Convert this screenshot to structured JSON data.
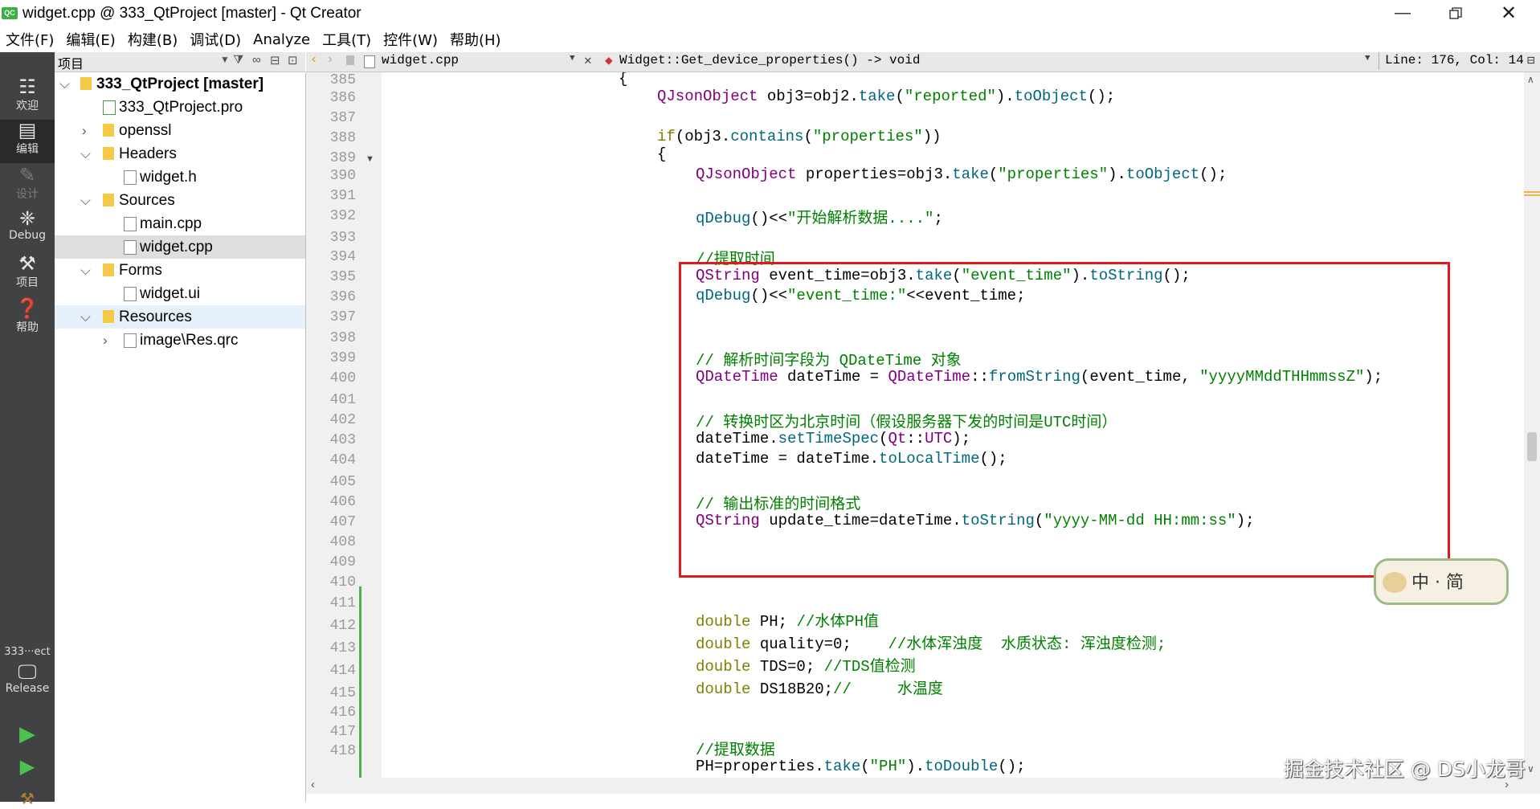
{
  "window": {
    "title": "widget.cpp @ 333_QtProject [master] - Qt Creator",
    "app_icon": "QC",
    "min_icon": "minimize-icon",
    "max_icon": "restore-icon",
    "close_icon": "close-icon"
  },
  "menu": [
    "文件(F)",
    "编辑(E)",
    "构建(B)",
    "调试(D)",
    "Analyze",
    "工具(T)",
    "控件(W)",
    "帮助(H)"
  ],
  "modes": [
    {
      "label": "欢迎",
      "icon": "grid-icon"
    },
    {
      "label": "编辑",
      "icon": "edit-icon"
    },
    {
      "label": "设计",
      "icon": "pencil-icon"
    },
    {
      "label": "Debug",
      "icon": "bug-icon"
    },
    {
      "label": "项目",
      "icon": "wrench-icon"
    },
    {
      "label": "帮助",
      "icon": "help-icon"
    }
  ],
  "kit": {
    "project": "333···ect",
    "config": "Release"
  },
  "project_pane": {
    "title": "项目"
  },
  "tree": [
    {
      "label": "333_QtProject [master]",
      "bold": true
    },
    {
      "label": "333_QtProject.pro"
    },
    {
      "label": "openssl"
    },
    {
      "label": "Headers"
    },
    {
      "label": "widget.h"
    },
    {
      "label": "Sources"
    },
    {
      "label": "main.cpp"
    },
    {
      "label": "widget.cpp"
    },
    {
      "label": "Forms"
    },
    {
      "label": "widget.ui"
    },
    {
      "label": "Resources"
    },
    {
      "label": "image\\Res.qrc"
    }
  ],
  "editor": {
    "file": "widget.cpp",
    "function": "Widget::Get_device_properties() -> void",
    "position": "Line: 176, Col: 14"
  },
  "line_numbers": [
    "385",
    "386",
    "387",
    "388",
    "389",
    "390",
    "391",
    "392",
    "393",
    "394",
    "395",
    "396",
    "397",
    "398",
    "399",
    "400",
    "401",
    "402",
    "403",
    "404",
    "405",
    "406",
    "407",
    "408",
    "409",
    "410",
    "411",
    "412",
    "413",
    "414",
    "415",
    "416",
    "417",
    "418"
  ],
  "code": {
    "l385": "{",
    "l386": "QJsonObject obj3=obj2.take(\"reported\").toObject();",
    "l389": "if(obj3.contains(\"properties\"))",
    "l390": "{",
    "l391": "QJsonObject properties=obj3.take(\"properties\").toObject();",
    "l393": "qDebug()<<\"开始解析数据....\";",
    "l395": "//提取时间",
    "l396": "QString event_time=obj3.take(\"event_time\").toString();",
    "l397": "qDebug()<<\"event_time:\"<<event_time;",
    "l400": "// 解析时间字段为 QDateTime 对象",
    "l401": "QDateTime dateTime = QDateTime::fromString(event_time, \"yyyyMMddTHHmmssZ\");",
    "l403": "// 转换时区为北京时间（假设服务器下发的时间是UTC时间）",
    "l404": "dateTime.setTimeSpec(Qt::UTC);",
    "l405": "dateTime = dateTime.toLocalTime();",
    "l407": "// 输出标准的时间格式",
    "l408": "QString update_time=dateTime.toString(\"yyyy-MM-dd HH:mm:ss\");",
    "l411": "double PH; //水体PH值",
    "l412": "double quality=0;    //水体浑浊度  水质状态: 浑浊度检测;",
    "l413": "double TDS=0; //TDS值检测",
    "l414": "double DS18B20;//     水温度",
    "l417": "//提取数据",
    "l418": "PH=properties.take(\"PH\").toDouble();"
  },
  "sticker": "中 · 简",
  "watermark": "掘金技术社区 @ DS小龙哥",
  "colors": {
    "highlight_box": "#e0191c",
    "mode_bar": "#404244",
    "keyword": "#808000",
    "type": "#800080",
    "string": "#008000"
  }
}
